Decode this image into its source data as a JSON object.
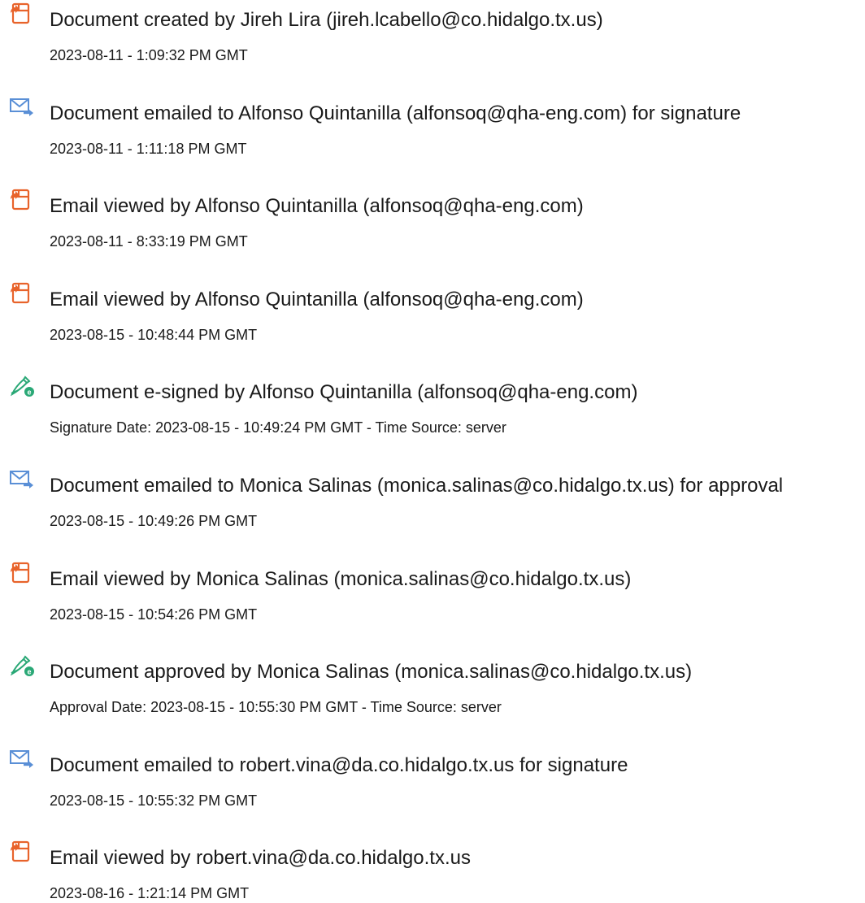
{
  "events": [
    {
      "icon": "document-created-icon",
      "title": "Document created by Jireh Lira (jireh.lcabello@co.hidalgo.tx.us)",
      "time": "2023-08-11 - 1:09:32 PM GMT"
    },
    {
      "icon": "email-sent-icon",
      "title": "Document emailed to Alfonso Quintanilla (alfonsoq@qha-eng.com) for signature",
      "time": "2023-08-11 - 1:11:18 PM GMT"
    },
    {
      "icon": "document-viewed-icon",
      "title": "Email viewed by Alfonso Quintanilla (alfonsoq@qha-eng.com)",
      "time": "2023-08-11 - 8:33:19 PM GMT"
    },
    {
      "icon": "document-viewed-icon",
      "title": "Email viewed by Alfonso Quintanilla (alfonsoq@qha-eng.com)",
      "time": "2023-08-15 - 10:48:44 PM GMT"
    },
    {
      "icon": "esign-pen-icon",
      "title": "Document e-signed by Alfonso Quintanilla (alfonsoq@qha-eng.com)",
      "time": "Signature Date: 2023-08-15 - 10:49:24 PM GMT - Time Source: server"
    },
    {
      "icon": "email-sent-icon",
      "title": "Document emailed to Monica Salinas (monica.salinas@co.hidalgo.tx.us) for approval",
      "time": "2023-08-15 - 10:49:26 PM GMT"
    },
    {
      "icon": "document-viewed-icon",
      "title": "Email viewed by Monica Salinas (monica.salinas@co.hidalgo.tx.us)",
      "time": "2023-08-15 - 10:54:26 PM GMT"
    },
    {
      "icon": "esign-pen-icon",
      "title": "Document approved by Monica Salinas (monica.salinas@co.hidalgo.tx.us)",
      "time": "Approval Date: 2023-08-15 - 10:55:30 PM GMT - Time Source: server"
    },
    {
      "icon": "email-sent-icon",
      "title": "Document emailed to robert.vina@da.co.hidalgo.tx.us for signature",
      "time": "2023-08-15 - 10:55:32 PM GMT"
    },
    {
      "icon": "document-viewed-icon",
      "title": "Email viewed by robert.vina@da.co.hidalgo.tx.us",
      "time": "2023-08-16 - 1:21:14 PM GMT"
    }
  ],
  "colors": {
    "document_icon": "#e8632b",
    "email_icon": "#5a8fd6",
    "pen_icon": "#2aa876",
    "text": "#1a1a1a"
  }
}
